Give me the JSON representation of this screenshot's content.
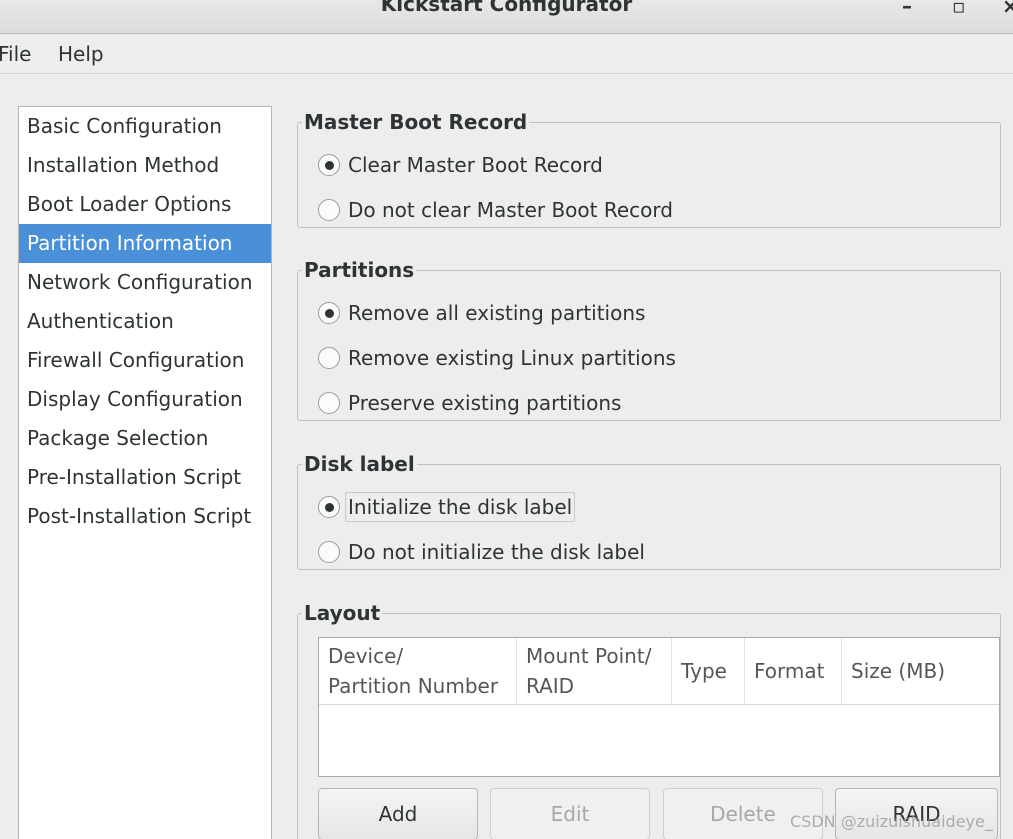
{
  "window": {
    "title": "Kickstart Configurator",
    "minimize_glyph": "–",
    "maximize_glyph": "▫",
    "close_glyph": "×"
  },
  "menu": {
    "file": "File",
    "help": "Help"
  },
  "sidebar": {
    "items": [
      {
        "label": "Basic Configuration"
      },
      {
        "label": "Installation Method"
      },
      {
        "label": "Boot Loader Options"
      },
      {
        "label": "Partition Information"
      },
      {
        "label": "Network Configuration"
      },
      {
        "label": "Authentication"
      },
      {
        "label": "Firewall Configuration"
      },
      {
        "label": "Display Configuration"
      },
      {
        "label": "Package Selection"
      },
      {
        "label": "Pre-Installation Script"
      },
      {
        "label": "Post-Installation Script"
      }
    ],
    "selected": "Partition Information"
  },
  "mbr": {
    "title": "Master Boot Record",
    "options": [
      {
        "label": "Clear Master Boot Record",
        "checked": true
      },
      {
        "label": "Do not clear Master Boot Record",
        "checked": false
      }
    ]
  },
  "partitions": {
    "title": "Partitions",
    "options": [
      {
        "label": "Remove all existing partitions",
        "checked": true
      },
      {
        "label": "Remove existing Linux partitions",
        "checked": false
      },
      {
        "label": "Preserve existing partitions",
        "checked": false
      }
    ]
  },
  "disklabel": {
    "title": "Disk label",
    "options": [
      {
        "label": "Initialize the disk label",
        "checked": true
      },
      {
        "label": "Do not initialize the disk label",
        "checked": false
      }
    ]
  },
  "layout": {
    "title": "Layout",
    "columns": [
      {
        "line1": "Device/",
        "line2": "Partition Number"
      },
      {
        "line1": "Mount Point/",
        "line2": "RAID"
      },
      {
        "line1": "Type",
        "line2": ""
      },
      {
        "line1": "Format",
        "line2": ""
      },
      {
        "line1": "Size (MB)",
        "line2": ""
      }
    ],
    "rows": [],
    "buttons": {
      "add": "Add",
      "edit": "Edit",
      "delete": "Delete",
      "raid": "RAID"
    }
  },
  "watermark": "CSDN @zuizuishuaideye_"
}
